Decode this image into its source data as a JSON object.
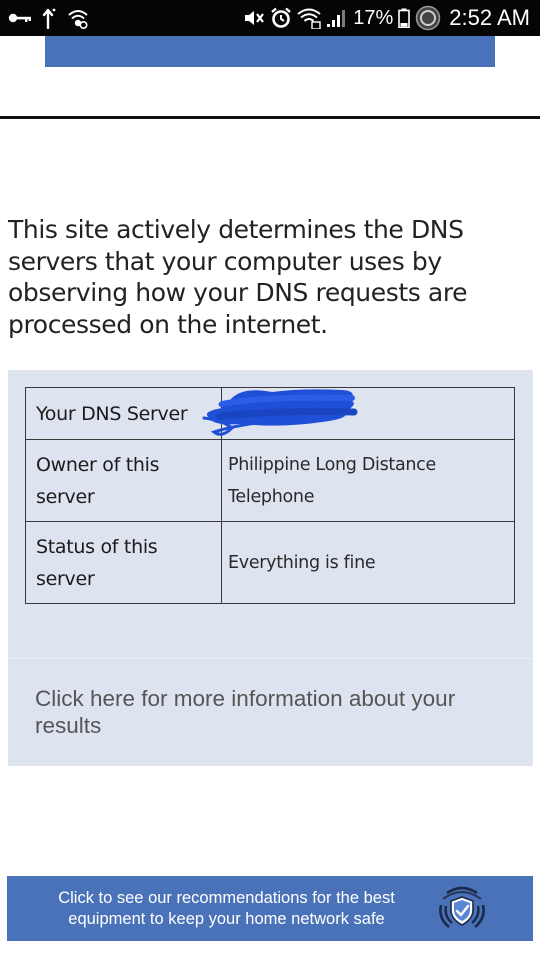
{
  "status_bar": {
    "icons": [
      "key-icon",
      "upload-arrow-icon",
      "wifi-calling-icon",
      "mute-icon",
      "alarm-icon",
      "wifi-icon",
      "signal-icon",
      "battery-icon",
      "sync-icon"
    ],
    "battery": "17%",
    "time": "2:52 AM"
  },
  "intro": {
    "text": "This site actively determines the DNS servers that your computer uses by observing how your DNS requests are processed on the internet."
  },
  "results": {
    "rows": [
      {
        "label": "Your DNS Server",
        "value": ""
      },
      {
        "label": "Owner of this server",
        "value": "Philippine Long Distance Telephone"
      },
      {
        "label": "Status of this server",
        "value": "Everything is fine"
      }
    ]
  },
  "info": {
    "link_text": "Click here for more information about your results"
  },
  "recommendation": {
    "text": "Click to see our recommendations for the best equipment to keep your home network safe",
    "icon": "shield-wifi-icon"
  },
  "colors": {
    "banner_blue": "#4a72b8",
    "panel_bg": "#dde4f0",
    "scribble_blue": "#1f4fd6"
  }
}
